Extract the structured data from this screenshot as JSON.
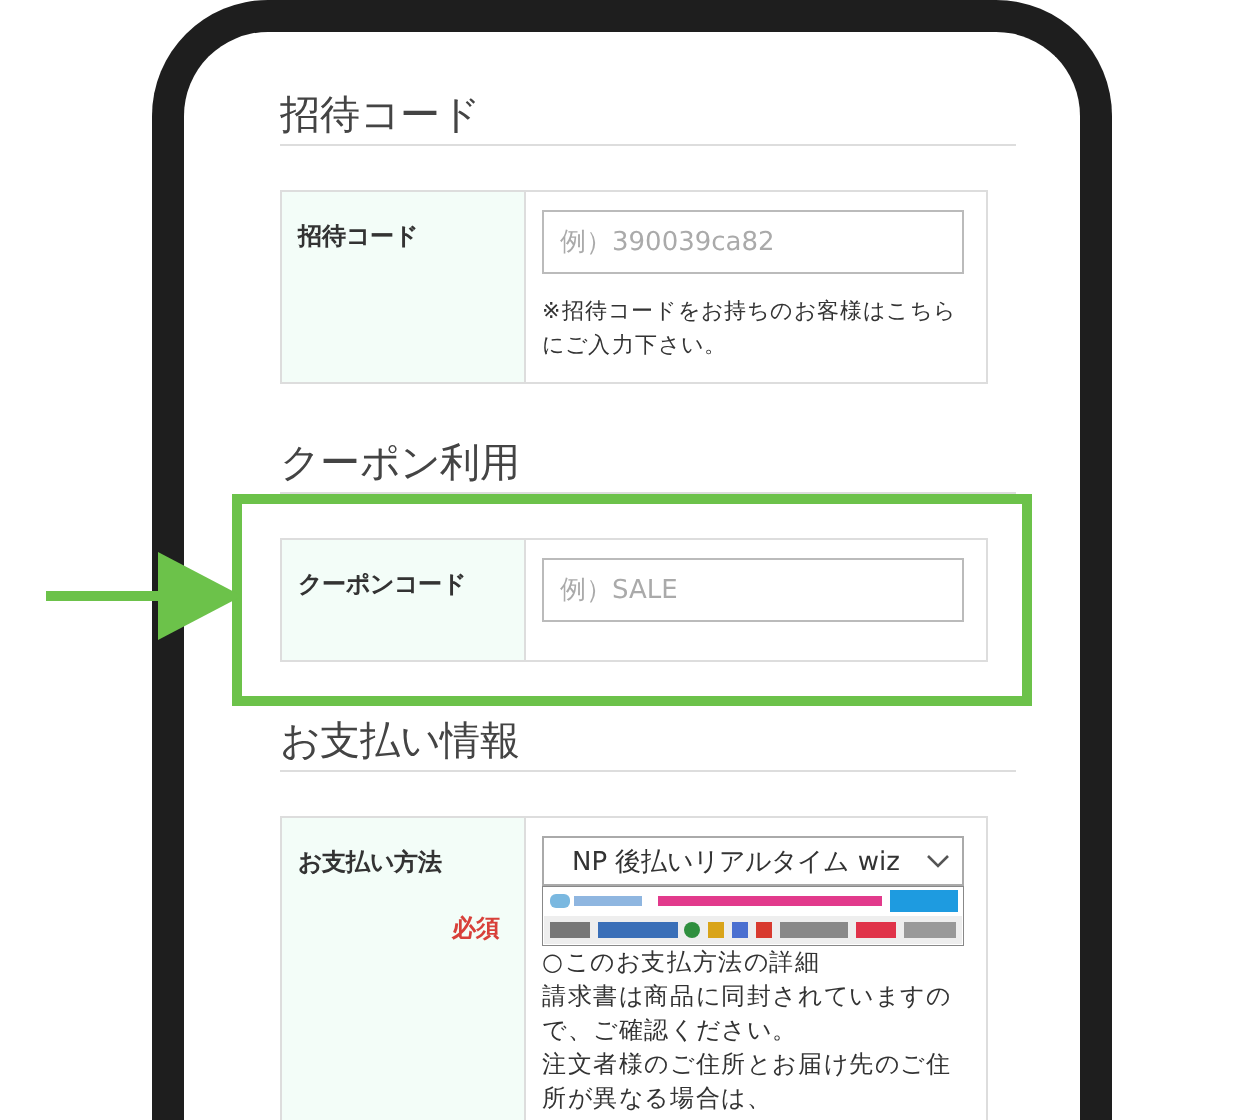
{
  "sections": [
    {
      "kind": "text",
      "heading": "招待コード",
      "highlighted": false,
      "label": "招待コード",
      "placeholder": "例）390039ca82",
      "note": "※招待コードをお持ちのお客様はこちらにご入力下さい。"
    },
    {
      "kind": "text",
      "heading": "クーポン利用",
      "highlighted": true,
      "label": "クーポンコード",
      "placeholder": "例）SALE"
    },
    {
      "kind": "select",
      "heading": "お支払い情報",
      "highlighted": false,
      "label": "お支払い方法",
      "required": "必須",
      "value": "NP 後払いリアルタイム wiz",
      "detail_link": "○このお支払方法の詳細",
      "lines": [
        "請求書は商品に同封されていますので、ご確認ください。",
        "注文者様のご住所とお届け先のご住所が異なる場合は、"
      ]
    }
  ]
}
